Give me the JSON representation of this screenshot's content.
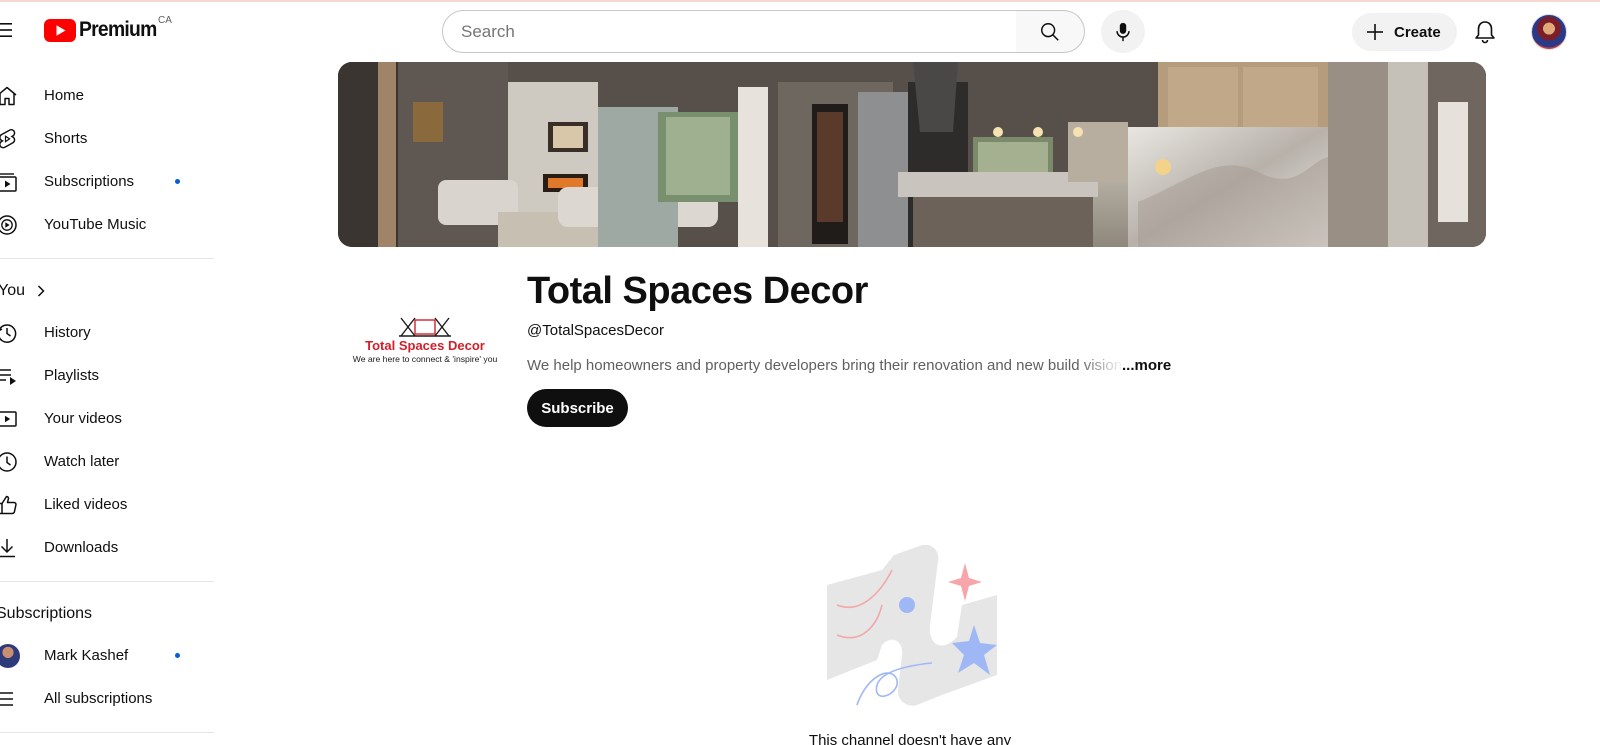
{
  "header": {
    "logo_text": "Premium",
    "region": "CA",
    "search_placeholder": "Search",
    "create_label": "Create"
  },
  "sidebar": {
    "main": [
      {
        "label": "Home",
        "icon": "home-icon"
      },
      {
        "label": "Shorts",
        "icon": "shorts-icon"
      },
      {
        "label": "Subscriptions",
        "icon": "subscriptions-icon",
        "dot": true
      },
      {
        "label": "YouTube Music",
        "icon": "music-icon"
      }
    ],
    "you_title": "You",
    "you": [
      {
        "label": "History",
        "icon": "history-icon"
      },
      {
        "label": "Playlists",
        "icon": "playlists-icon"
      },
      {
        "label": "Your videos",
        "icon": "your-videos-icon"
      },
      {
        "label": "Watch later",
        "icon": "clock-icon"
      },
      {
        "label": "Liked videos",
        "icon": "thumbs-up-icon"
      },
      {
        "label": "Downloads",
        "icon": "download-icon"
      }
    ],
    "subscriptions_title": "Subscriptions",
    "subscriptions": [
      {
        "label": "Mark Kashef",
        "dot": true
      },
      {
        "label": "All subscriptions"
      }
    ]
  },
  "channel": {
    "name": "Total Spaces Decor",
    "handle": "@TotalSpacesDecor",
    "description": "We help homeowners and property developers bring their renovation and new build vision",
    "more_label": "...more",
    "subscribe_label": "Subscribe",
    "logo_title": "Total Spaces Decor",
    "logo_tagline": "We are here to connect & 'inspire' you",
    "empty_message": "This channel doesn't have any content"
  },
  "colors": {
    "brand_red": "#ff0000",
    "accent_blue": "#065fd4",
    "text_primary": "#0f0f0f",
    "text_secondary": "#606060"
  }
}
